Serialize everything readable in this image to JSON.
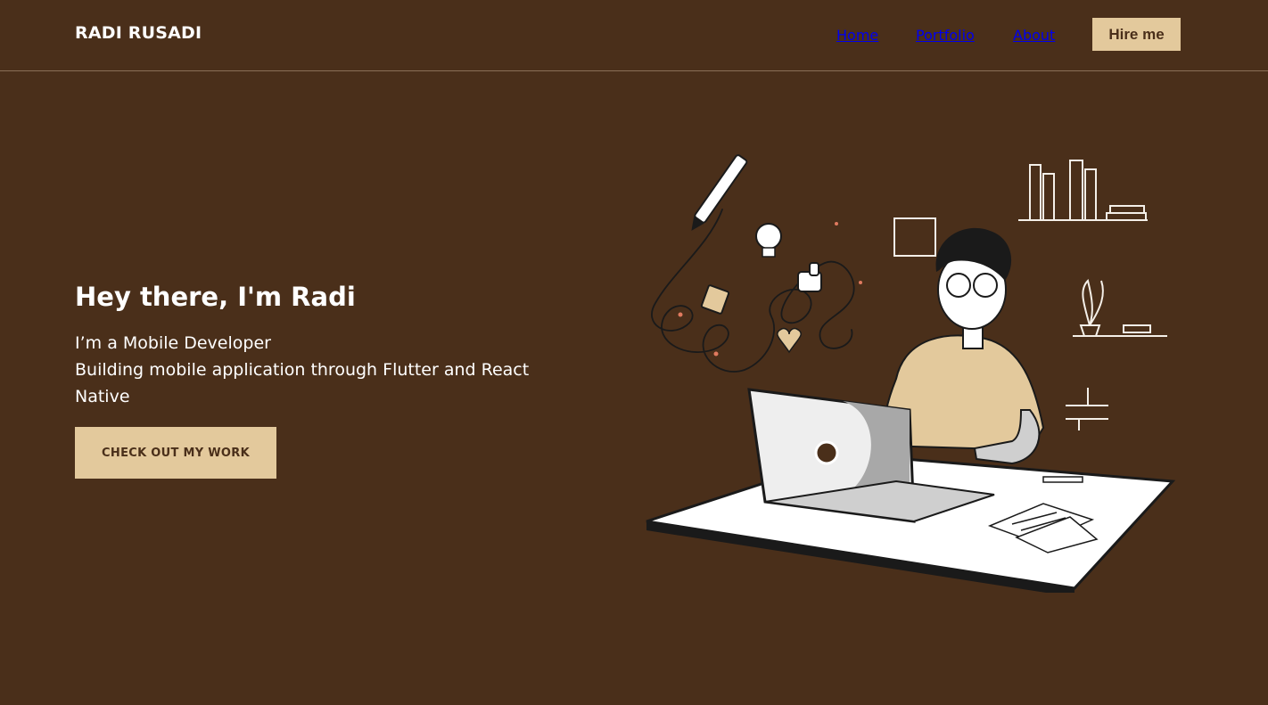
{
  "header": {
    "brand": "RADI RUSADI",
    "nav": [
      "Home",
      "Portfolio",
      "About"
    ],
    "hire_label": "Hire me"
  },
  "hero": {
    "title": "Hey there, I'm Radi",
    "line1": "I’m a Mobile Developer",
    "line2": "Building mobile application through Flutter and React Native",
    "cta_label": "CHECK OUT MY WORK"
  },
  "colors": {
    "background": "#4a2f1a",
    "accent": "#e3c99c",
    "text": "#ffffff"
  },
  "illustration": {
    "subject": "developer-working-on-laptop"
  }
}
